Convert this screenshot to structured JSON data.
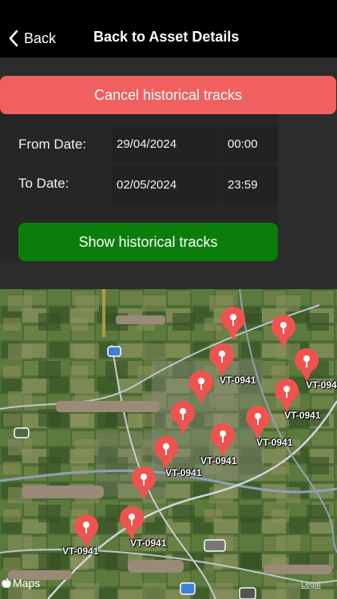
{
  "nav": {
    "back_label": "Back",
    "title": "Back to Asset Details"
  },
  "cancel_label": "Cancel historical tracks",
  "form": {
    "from_label": "From Date:",
    "from_date": "29/04/2024",
    "from_time": "00:00",
    "to_label": "To Date:",
    "to_date": "02/05/2024",
    "to_time": "23:59"
  },
  "show_label": "Show historical tracks",
  "map": {
    "attribution": "Maps",
    "legal": "Legal",
    "pin_color": "#ef5350",
    "labels": {
      "l1": "VT-0941",
      "l2": "VT-094",
      "l3": "VT-0941",
      "l4": "VT-0941",
      "l5": "VT-0941",
      "l6": "VT-0941",
      "l7": "VT-0941",
      "l8": "VT-0941"
    }
  }
}
